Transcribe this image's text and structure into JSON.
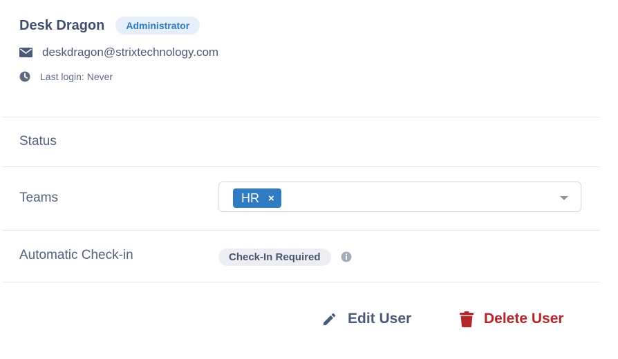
{
  "user": {
    "name": "Desk Dragon",
    "role": "Administrator",
    "email": "deskdragon@strixtechnology.com",
    "last_login": "Last login: Never"
  },
  "fields": {
    "status_label": "Status",
    "teams_label": "Teams",
    "teams_selected": [
      {
        "label": "HR",
        "remove": "×"
      }
    ],
    "checkin_label": "Automatic Check-in",
    "checkin_value": "Check-In Required"
  },
  "actions": {
    "edit_label": "Edit User",
    "delete_label": "Delete User"
  },
  "icons": {
    "email": "envelope-icon",
    "last_login": "clock-icon",
    "info": "info-icon",
    "edit": "pencil-icon",
    "delete": "trash-icon",
    "dropdown": "caret-down-icon"
  },
  "colors": {
    "accent": "#2f7cc3",
    "badge_bg": "#e4effa",
    "delete": "#b3262a",
    "text": "#4a5a78"
  }
}
